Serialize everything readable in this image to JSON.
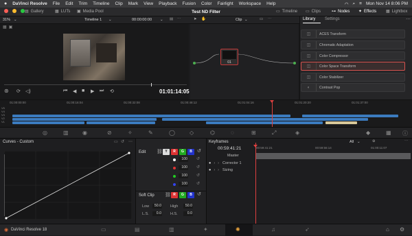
{
  "menubar": {
    "app": "DaVinci Resolve",
    "items": [
      "File",
      "Edit",
      "Trim",
      "Timeline",
      "Clip",
      "Mark",
      "View",
      "Playback",
      "Fusion",
      "Color",
      "Fairlight",
      "Workspace",
      "Help"
    ],
    "datetime": "Mon Nov 14  8:06 PM"
  },
  "topbar": {
    "tabs_left": [
      "Gallery",
      "LUTs",
      "Media Pool"
    ],
    "project_title": "Test ND Filter",
    "tabs_right": [
      "Timeline",
      "Clips",
      "Nodes",
      "Effects",
      "Lightbox"
    ]
  },
  "viewer": {
    "zoom": "31%",
    "timeline_name": "Timeline 1",
    "timecode_top": "00:00:00:00",
    "timecode": "01:01:14:05"
  },
  "nodes": {
    "mode": "Clip",
    "node_label": "01"
  },
  "library": {
    "tabs": [
      "Library",
      "Settings"
    ],
    "items": [
      {
        "label": "ACES Transform",
        "selected": false
      },
      {
        "label": "Chromatic Adaptation",
        "selected": false
      },
      {
        "label": "Color Compressor",
        "selected": false
      },
      {
        "label": "Color Space Transform",
        "selected": true
      },
      {
        "label": "Color Stabilizer",
        "selected": false
      },
      {
        "label": "Contrast Pop",
        "selected": false
      }
    ]
  },
  "timeline": {
    "ruler": [
      "01:00:00:00",
      "01:00:16:04",
      "01:00:32:08",
      "01:00:48:12",
      "01:01:04:16",
      "01:01:20:20",
      "01:01:37:00"
    ],
    "tracks": [
      "V5",
      "V4",
      "V3",
      "V2",
      "V1"
    ]
  },
  "curves": {
    "title": "Curves - Custom"
  },
  "edit": {
    "title": "Edit",
    "channels": [
      "Y",
      "R",
      "G",
      "B"
    ],
    "values": [
      "100",
      "100",
      "100",
      "100"
    ],
    "soft_clip_title": "Soft Clip",
    "low_label": "Low",
    "low_value": "50.0",
    "high_label": "High",
    "high_value": "50.0",
    "ls_label": "L.S.",
    "ls_value": "0.0",
    "hs_label": "H.S.",
    "hs_value": "0.0"
  },
  "keyframes": {
    "title": "Keyframes",
    "filter": "All",
    "timecode": "00:59:41:21",
    "ruler": [
      "00:59:41:21",
      "00:59:56:14",
      "01:00:11:07"
    ],
    "rows": [
      "Master",
      "Corrector 1",
      "Sizing"
    ]
  },
  "bottombar": {
    "app_name": "DaVinci Resolve 18"
  }
}
